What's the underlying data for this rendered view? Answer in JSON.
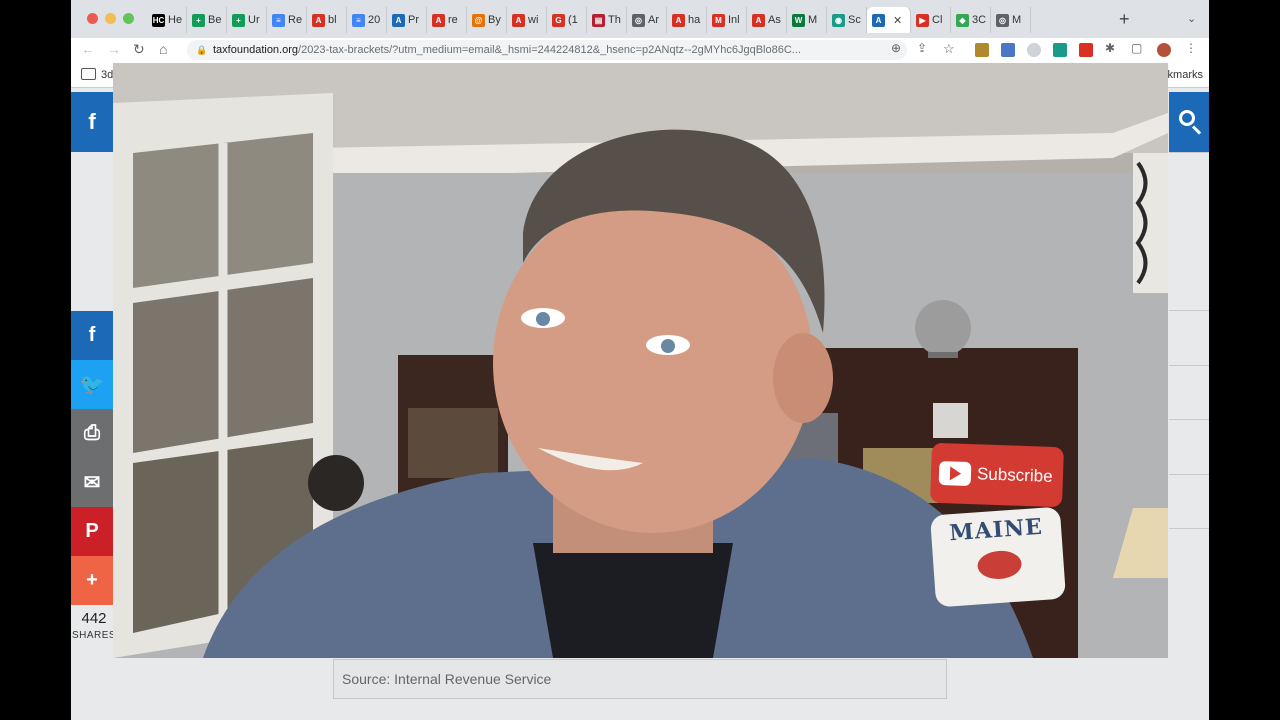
{
  "browser": {
    "tabs": [
      {
        "favicon": "HC",
        "label": "He",
        "color": "#000000"
      },
      {
        "favicon": "+",
        "label": "Be",
        "color": "#0f9d58"
      },
      {
        "favicon": "+",
        "label": "Ur",
        "color": "#0f9d58"
      },
      {
        "favicon": "≡",
        "label": "Re",
        "color": "#4285f4"
      },
      {
        "favicon": "A",
        "label": "bl",
        "color": "#d93025"
      },
      {
        "favicon": "≡",
        "label": "20",
        "color": "#4285f4"
      },
      {
        "favicon": "A",
        "label": "Pr",
        "color": "#1c6ab7"
      },
      {
        "favicon": "A",
        "label": "re",
        "color": "#d93025"
      },
      {
        "favicon": "@",
        "label": "By",
        "color": "#e8710a"
      },
      {
        "favicon": "A",
        "label": "wi",
        "color": "#d93025"
      },
      {
        "favicon": "G",
        "label": "(1",
        "color": "#d93025"
      },
      {
        "favicon": "▤",
        "label": "Th",
        "color": "#b22234"
      },
      {
        "favicon": "◎",
        "label": "Ar",
        "color": "#5f6368"
      },
      {
        "favicon": "A",
        "label": "ha",
        "color": "#d93025"
      },
      {
        "favicon": "M",
        "label": "Inl",
        "color": "#d93025"
      },
      {
        "favicon": "A",
        "label": "As",
        "color": "#d93025"
      },
      {
        "favicon": "W",
        "label": "M",
        "color": "#0a7a3c"
      },
      {
        "favicon": "◉",
        "label": "Sc",
        "color": "#1a9b8a"
      },
      {
        "favicon": "A",
        "label": "",
        "color": "#1c6ab7",
        "active": true
      },
      {
        "favicon": "▶",
        "label": "Cl",
        "color": "#d93025"
      },
      {
        "favicon": "◆",
        "label": "3C",
        "color": "#34a853"
      },
      {
        "favicon": "◎",
        "label": "M",
        "color": "#5f6368"
      }
    ],
    "tab_close": "✕",
    "new_tab": "+",
    "tab_menu": "⌄",
    "url_domain": "taxfoundation.org",
    "url_path": "/2023-tax-brackets/?utm_medium=email&_hsmi=244224812&_hsenc=p2ANqtz--2gMYhc6JgqBlo86C...",
    "bookmarks_left": "3d",
    "bookmarks_right": "kmarks"
  },
  "page": {
    "facebook_top": "f",
    "share_buttons": [
      {
        "name": "facebook",
        "glyph": "f",
        "color": "#1c6ab7"
      },
      {
        "name": "twitter",
        "glyph": "🐦",
        "color": "#1da1f2"
      },
      {
        "name": "print",
        "glyph": "⎙",
        "color": "#6d6e70"
      },
      {
        "name": "email",
        "glyph": "✉",
        "color": "#6d6e70"
      },
      {
        "name": "pinterest",
        "glyph": "P",
        "color": "#cb2027"
      },
      {
        "name": "more",
        "glyph": "+",
        "color": "#f06446"
      }
    ],
    "share_count": "442",
    "share_label": "SHARES",
    "source_text": "Source: Internal Revenue Service"
  },
  "video": {
    "pillow_text": "Subscribe",
    "maine_text": "MAINE"
  }
}
